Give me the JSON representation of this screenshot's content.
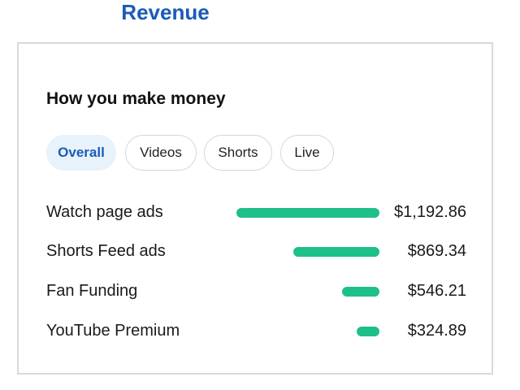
{
  "tab": {
    "label": "Revenue"
  },
  "section": {
    "title": "How you make money"
  },
  "filters": [
    {
      "label": "Overall",
      "active": true
    },
    {
      "label": "Videos",
      "active": false
    },
    {
      "label": "Shorts",
      "active": false
    },
    {
      "label": "Live",
      "active": false
    }
  ],
  "colors": {
    "accent": "#1a5bb8",
    "bar": "#1dbf8a",
    "active_chip_bg": "#e7f2fb"
  },
  "chart_data": {
    "type": "bar",
    "categories": [
      "Watch page ads",
      "Shorts Feed ads",
      "Fan Funding",
      "YouTube Premium"
    ],
    "values": [
      1192.86,
      869.34,
      546.21,
      324.89
    ],
    "value_labels": [
      "$1,192.86",
      "$869.34",
      "$546.21",
      "$324.89"
    ],
    "bar_fraction": [
      1.0,
      0.6,
      0.26,
      0.16
    ]
  }
}
